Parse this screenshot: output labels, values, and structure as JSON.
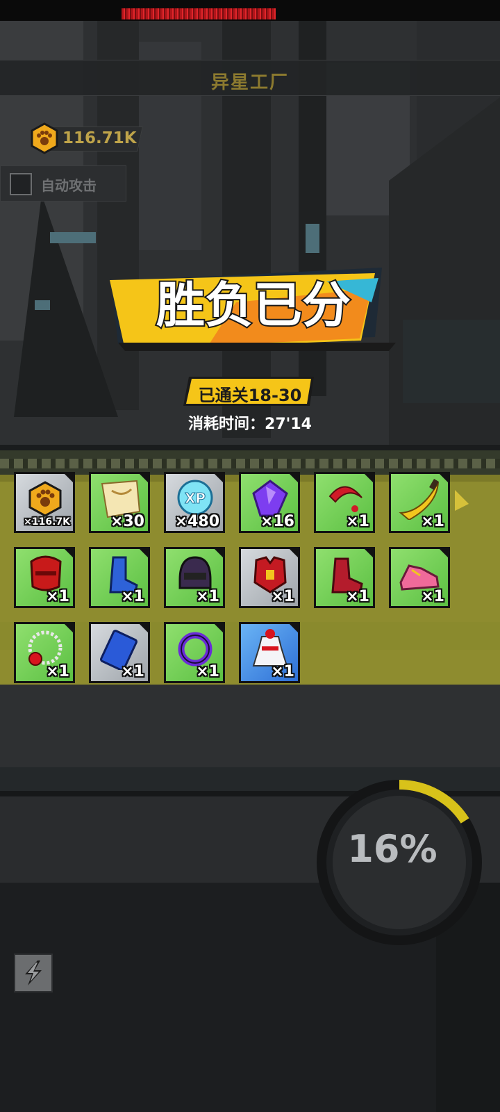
{
  "header": {
    "title": "异星工厂"
  },
  "currency": {
    "value": "116.71K",
    "icon": "paw-coin-icon"
  },
  "auto_attack": {
    "label": "自动攻击",
    "checked": false
  },
  "result": {
    "banner_text": "胜负已分",
    "stage_text": "已通关18-30",
    "time_text": "消耗时间：27'14"
  },
  "rewards": [
    {
      "name": "paw-coin",
      "count": "×116.7K",
      "rarity": "gray"
    },
    {
      "name": "scroll",
      "count": "×30",
      "rarity": "green"
    },
    {
      "name": "xp-orb",
      "count": "×480",
      "rarity": "gray"
    },
    {
      "name": "purple-gem",
      "count": "×16",
      "rarity": "green"
    },
    {
      "name": "red-ring",
      "count": "×1",
      "rarity": "green"
    },
    {
      "name": "golden-blade",
      "count": "×1",
      "rarity": "green"
    },
    {
      "name": "red-helmet",
      "count": "×1",
      "rarity": "green"
    },
    {
      "name": "blue-boot",
      "count": "×1",
      "rarity": "green"
    },
    {
      "name": "combat-helmet",
      "count": "×1",
      "rarity": "green"
    },
    {
      "name": "red-chest-armor",
      "count": "×1",
      "rarity": "gray"
    },
    {
      "name": "red-boot",
      "count": "×1",
      "rarity": "green"
    },
    {
      "name": "pink-sneaker",
      "count": "×1",
      "rarity": "green"
    },
    {
      "name": "pearl-necklace",
      "count": "×1",
      "rarity": "green"
    },
    {
      "name": "blue-card",
      "count": "×1",
      "rarity": "gray"
    },
    {
      "name": "purple-ring",
      "count": "×1",
      "rarity": "green"
    },
    {
      "name": "maid-outfit",
      "count": "×1",
      "rarity": "blue"
    }
  ],
  "progress": {
    "percent_text": "16%",
    "value": 0.16
  },
  "skill_button": {
    "icon": "lightning-icon"
  },
  "colors": {
    "accent": "#f5c518",
    "panel": "#8e8c2f",
    "progress": "#d8c21a"
  }
}
